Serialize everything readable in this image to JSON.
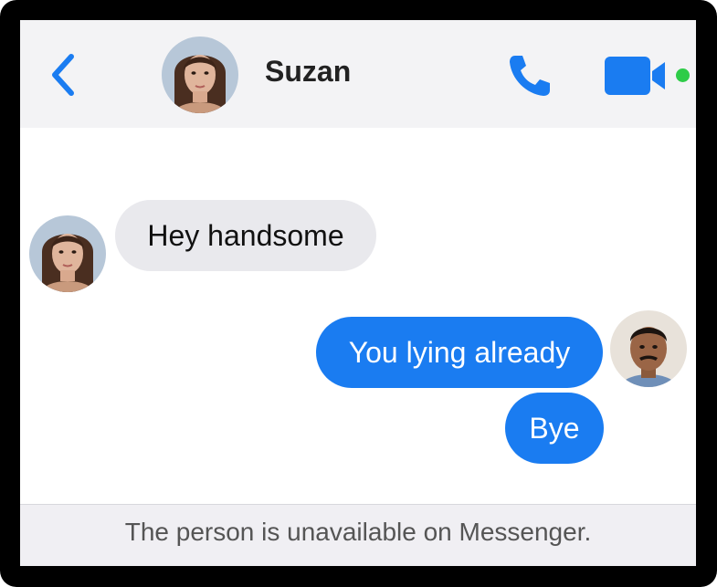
{
  "header": {
    "contact_name": "Suzan",
    "icons": {
      "back": "chevron-left-icon",
      "call": "phone-icon",
      "video": "video-camera-icon"
    },
    "online": true
  },
  "messages": [
    {
      "direction": "incoming",
      "text": "Hey handsome"
    },
    {
      "direction": "outgoing",
      "text": "You lying already"
    },
    {
      "direction": "outgoing",
      "text": "Bye"
    }
  ],
  "footer": {
    "status_text": "The person is unavailable on Messenger."
  },
  "colors": {
    "accent": "#1a7cf1",
    "incoming_bubble": "#e9e9ed",
    "header_bg": "#f3f3f5",
    "online": "#2ecc48"
  }
}
